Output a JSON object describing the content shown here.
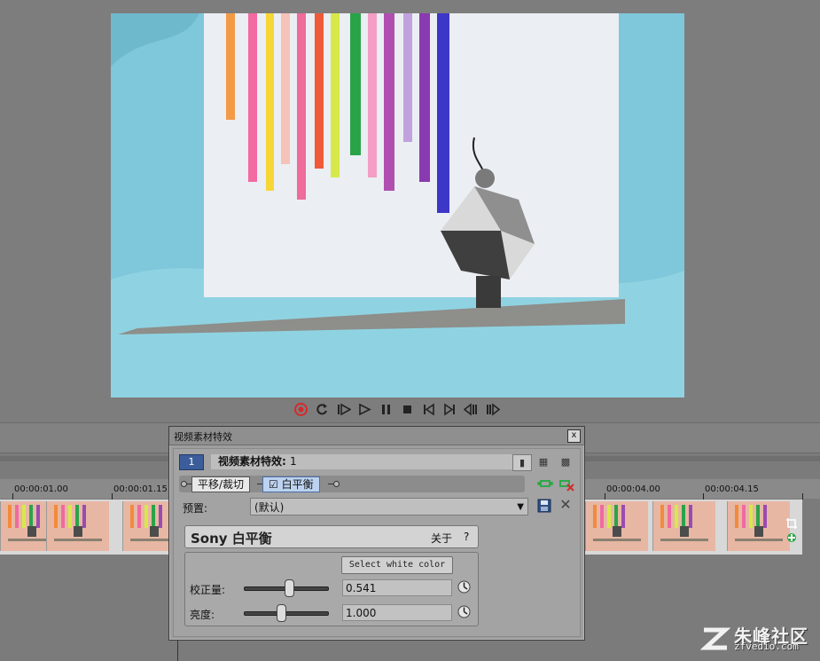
{
  "dialog": {
    "title": "视频素材特效",
    "close_glyph": "x",
    "chain_index": "1",
    "chain_label_prefix": "视频素材特效: ",
    "chain_label_count": "1",
    "view_icons": [
      "single-view-icon",
      "grid-view-icon",
      "wide-grid-view-icon"
    ],
    "plugins": [
      "平移/裁切",
      "白平衡"
    ],
    "preset_label": "预置:",
    "preset_value": "(默认)",
    "plugin_name": "Sony 白平衡",
    "about_label": "关于",
    "help_label": "?",
    "select_white_label": "Select white color",
    "params": [
      {
        "label": "校正量:",
        "value": "0.541",
        "level": 0.541
      },
      {
        "label": "亮度:",
        "value": "1.000",
        "level": 0.45
      }
    ]
  },
  "timeline": {
    "ticks": [
      "00:00:01.00",
      "00:00:01.15",
      "00:00:04.00",
      "00:00:04.15"
    ]
  },
  "transport_icons": [
    "record-icon",
    "loop-icon",
    "play-from-start-icon",
    "play-icon",
    "pause-icon",
    "stop-icon",
    "go-to-start-icon",
    "go-to-end-icon",
    "previous-frame-icon",
    "next-frame-icon"
  ],
  "watermark": {
    "main": "朱峰社区",
    "sub": "zfvedio.com"
  },
  "colors": {
    "accent": "#3b5d9a",
    "record": "#d42a2a",
    "track_icon_green": "#2ea84a"
  }
}
